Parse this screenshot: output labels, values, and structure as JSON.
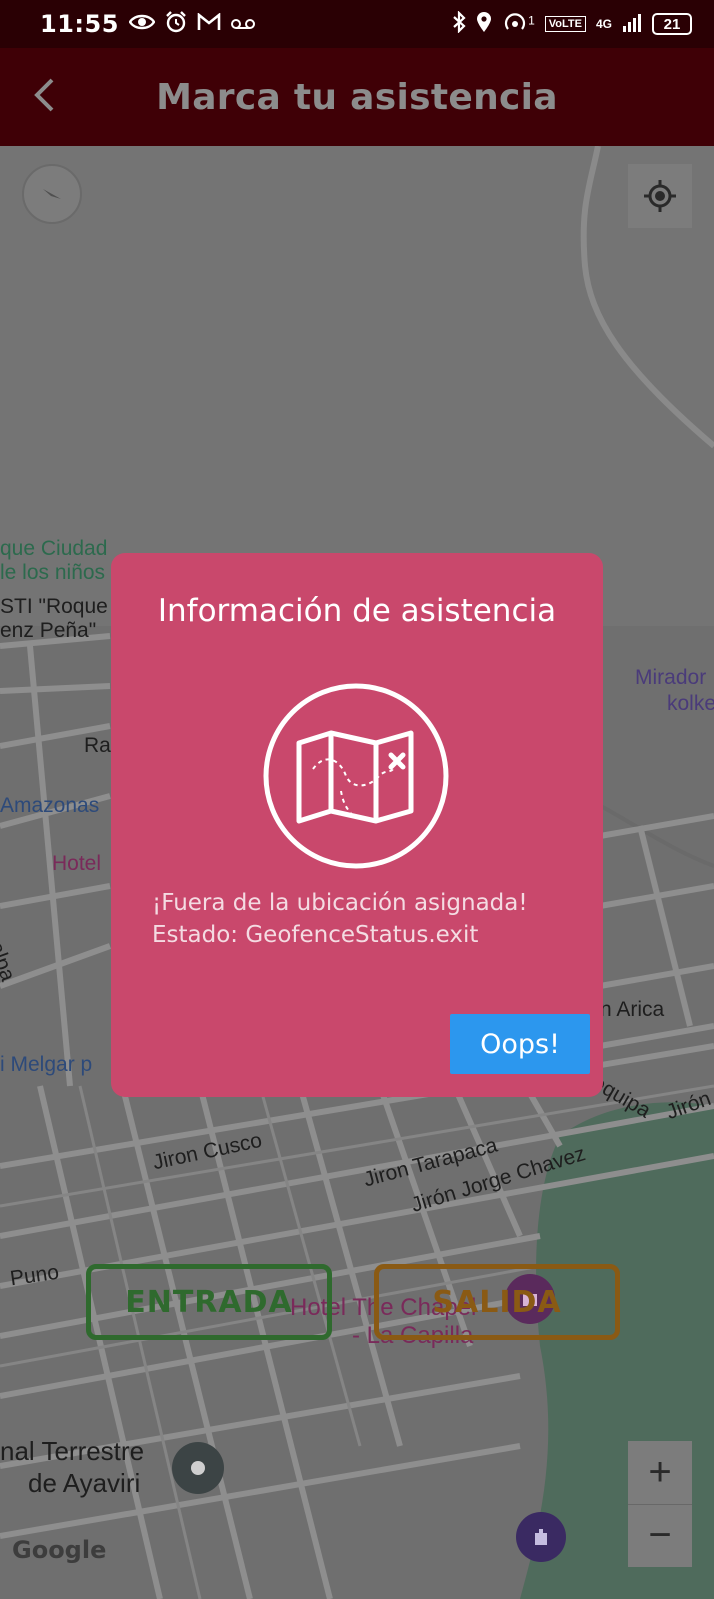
{
  "status_bar": {
    "time": "11:55",
    "signal_sup": "1",
    "volte": "VoLTE",
    "network": "4G",
    "battery": "21"
  },
  "app_bar": {
    "title": "Marca tu asistencia"
  },
  "map": {
    "labels": {
      "place_1a": "que Ciudad",
      "place_1b": "le los niños",
      "place_2a": "STI \"Roque",
      "place_2b": "enz Peña\"",
      "mirador_a": "Mirador",
      "mirador_b": "kolke",
      "ra": "Ra",
      "amazonas": "Amazonas",
      "hotel": "Hotel",
      "ualpa": "ualpa",
      "arica": "n Arica",
      "melgar": "i Melgar p",
      "jiron_cusco": "Jiron Cusco",
      "jiron_tarapaca": "Jiron Tarapaca",
      "jiron_chavez": "Jirón Jorge Chavez",
      "arequipa": "Arequipa",
      "jiron_right": "Jirón",
      "puno": "Puno",
      "hotel_chapel_a": "Hotel The Chapel",
      "hotel_chapel_b": "- La Capilla",
      "terminal_a": "nal Terrestre",
      "terminal_b": "de Ayaviri",
      "google": "Google"
    },
    "zoom_in": "+",
    "zoom_out": "−"
  },
  "actions": {
    "entrada": "ENTRADA",
    "salida": "SALIDA"
  },
  "dialog": {
    "title": "Información de asistencia",
    "icon": "map-icon",
    "message_line1": "¡Fuera de la ubicación asignada!",
    "message_line2": "Estado: GeofenceStatus.exit",
    "button": "Oops!"
  },
  "colors": {
    "status_bar": "#2a0004",
    "app_bar": "#3f0006",
    "dialog": "#c9486c",
    "dialog_button": "#2c97ee",
    "entrada": "#2f6a2e",
    "salida": "#8a5a14"
  }
}
